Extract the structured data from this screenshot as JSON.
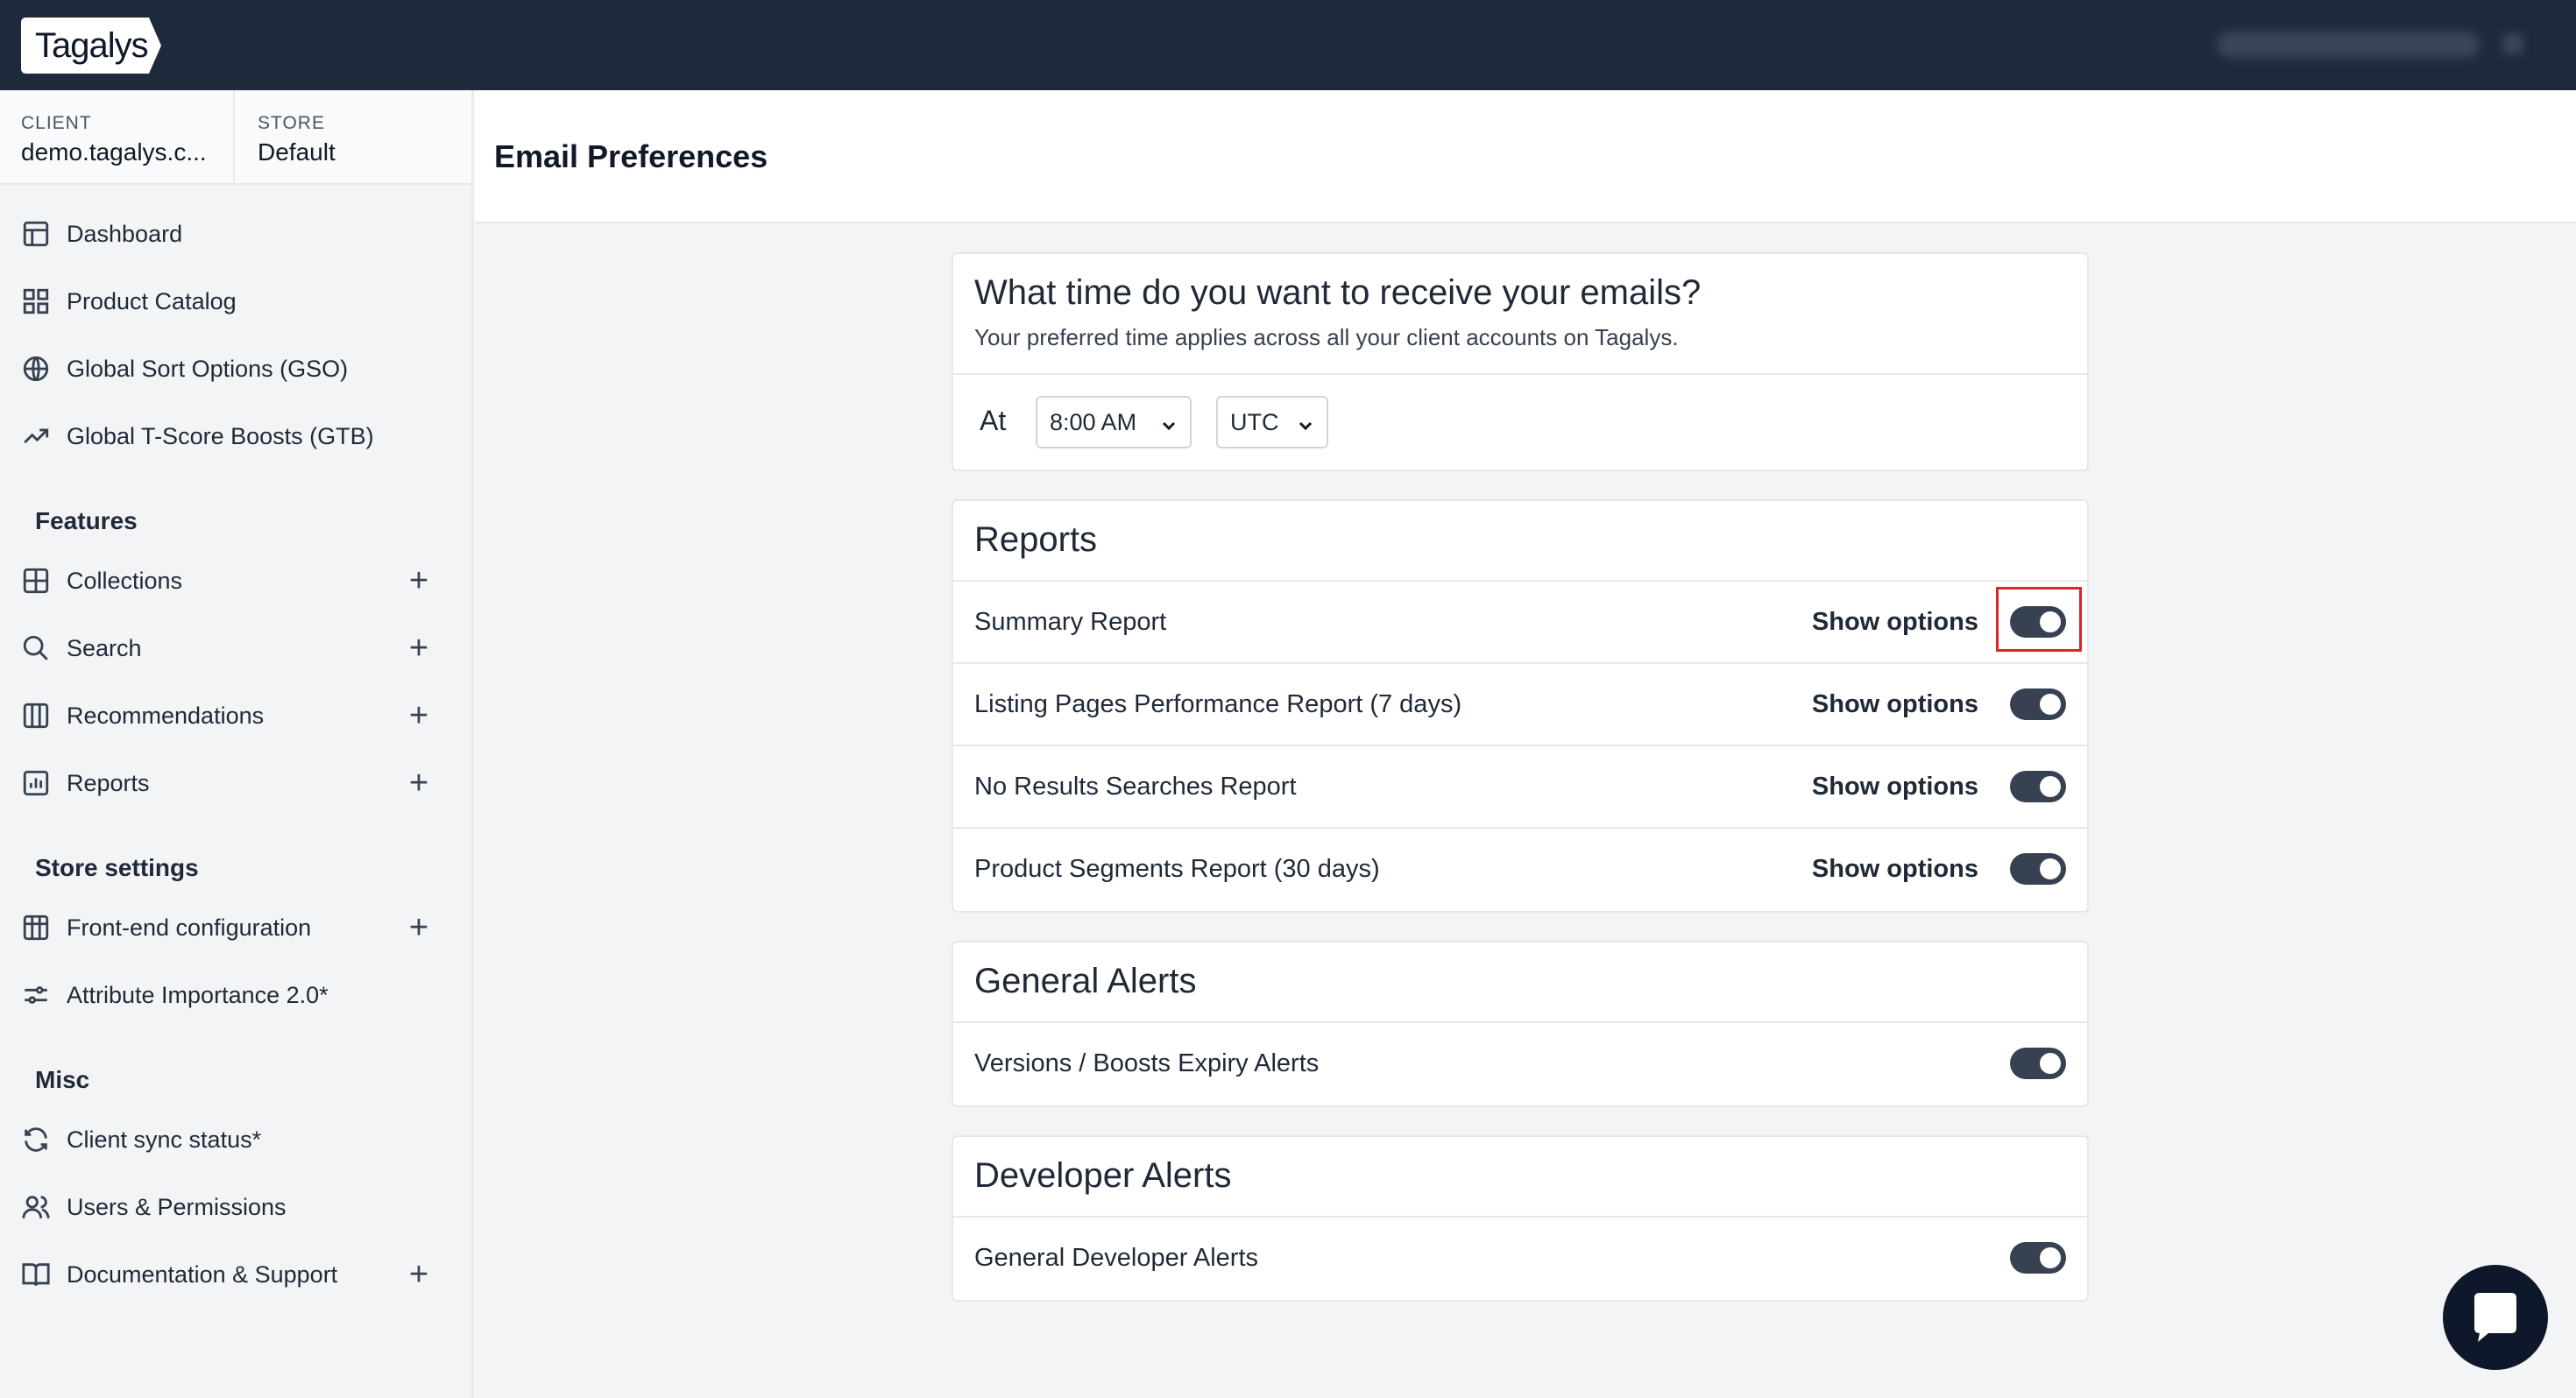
{
  "brand": {
    "logo_text": "Tagalys"
  },
  "context": {
    "client_label": "CLIENT",
    "client_value": "demo.tagalys.c...",
    "store_label": "STORE",
    "store_value": "Default"
  },
  "nav": {
    "top": [
      {
        "label": "Dashboard",
        "icon": "layout-icon"
      },
      {
        "label": "Product Catalog",
        "icon": "grid-icon"
      },
      {
        "label": "Global Sort Options (GSO)",
        "icon": "globe-icon"
      },
      {
        "label": "Global T-Score Boosts (GTB)",
        "icon": "trending-up-icon"
      }
    ],
    "features_title": "Features",
    "features": [
      {
        "label": "Collections",
        "icon": "collections-icon"
      },
      {
        "label": "Search",
        "icon": "search-icon"
      },
      {
        "label": "Recommendations",
        "icon": "columns-icon"
      },
      {
        "label": "Reports",
        "icon": "bar-chart-icon"
      }
    ],
    "store_title": "Store settings",
    "store": [
      {
        "label": "Front-end configuration",
        "icon": "table-icon"
      },
      {
        "label": "Attribute Importance 2.0*",
        "icon": "sliders-icon"
      }
    ],
    "misc_title": "Misc",
    "misc": [
      {
        "label": "Client sync status*",
        "icon": "refresh-icon"
      },
      {
        "label": "Users & Permissions",
        "icon": "users-icon"
      },
      {
        "label": "Documentation & Support",
        "icon": "book-icon"
      }
    ]
  },
  "page": {
    "title": "Email Preferences"
  },
  "time_card": {
    "title": "What time do you want to receive your emails?",
    "subtitle": "Your preferred time applies across all your client accounts on Tagalys.",
    "at_label": "At",
    "time_value": "8:00 AM",
    "tz_value": "UTC"
  },
  "reports": {
    "title": "Reports",
    "options_label": "Show options",
    "items": [
      {
        "label": "Summary Report",
        "enabled": true
      },
      {
        "label": "Listing Pages Performance Report (7 days)",
        "enabled": true
      },
      {
        "label": "No Results Searches Report",
        "enabled": true
      },
      {
        "label": "Product Segments Report (30 days)",
        "enabled": true
      }
    ]
  },
  "general_alerts": {
    "title": "General Alerts",
    "items": [
      {
        "label": "Versions / Boosts Expiry Alerts",
        "enabled": true
      }
    ]
  },
  "developer_alerts": {
    "title": "Developer Alerts",
    "items": [
      {
        "label": "General Developer Alerts",
        "enabled": true
      }
    ]
  },
  "colors": {
    "topbar": "#1e293b",
    "toggle_on": "#374151",
    "highlight": "#dc2626"
  }
}
